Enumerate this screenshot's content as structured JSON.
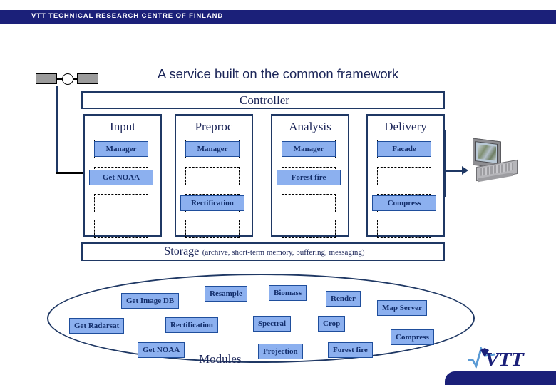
{
  "header": {
    "organization": "VTT TECHNICAL RESEARCH CENTRE OF FINLAND",
    "bar_color": "#1b2079"
  },
  "slide": {
    "title": "A service built on the common framework",
    "accent_color": "#1f3864",
    "chip_fill": "#8cb0ef",
    "chip_border": "#1f4e9c",
    "text_color": "#1b2558"
  },
  "diagram": {
    "controller": {
      "label": "Controller"
    },
    "columns": [
      {
        "title": "Input",
        "slots": [
          {
            "label": "Manager",
            "filled": true
          },
          {
            "label": "Get NOAA",
            "filled": true
          },
          {
            "label": "",
            "filled": false
          },
          {
            "label": "",
            "filled": false
          }
        ]
      },
      {
        "title": "Preproc",
        "slots": [
          {
            "label": "Manager",
            "filled": true
          },
          {
            "label": "",
            "filled": false
          },
          {
            "label": "Rectification",
            "filled": true
          },
          {
            "label": "",
            "filled": false
          }
        ]
      },
      {
        "title": "Analysis",
        "slots": [
          {
            "label": "Manager",
            "filled": true
          },
          {
            "label": "Forest fire",
            "filled": true
          },
          {
            "label": "",
            "filled": false
          },
          {
            "label": "",
            "filled": false
          }
        ]
      },
      {
        "title": "Delivery",
        "slots": [
          {
            "label": "Facade",
            "filled": true
          },
          {
            "label": "",
            "filled": false
          },
          {
            "label": "Compress",
            "filled": true
          },
          {
            "label": "",
            "filled": false
          }
        ]
      }
    ],
    "storage": {
      "title": "Storage",
      "subtitle": "(archive, short-term memory, buffering, messaging)"
    },
    "modules": {
      "label": "Modules",
      "items": [
        {
          "label": "Get Image DB"
        },
        {
          "label": "Resample"
        },
        {
          "label": "Biomass"
        },
        {
          "label": "Render"
        },
        {
          "label": "Map Server"
        },
        {
          "label": "Get Radarsat"
        },
        {
          "label": "Rectification"
        },
        {
          "label": "Spectral"
        },
        {
          "label": "Crop"
        },
        {
          "label": "Compress"
        },
        {
          "label": "Get NOAA"
        },
        {
          "label": "Projection"
        },
        {
          "label": "Forest fire"
        }
      ]
    },
    "icons": {
      "satellite": "satellite-icon",
      "client": "laptop-icon",
      "input_arrow": "arrow-right-icon",
      "output_arrow": "arrow-right-icon"
    }
  },
  "footer": {
    "logo_text": "VTT",
    "bar_color": "#1b2079"
  }
}
